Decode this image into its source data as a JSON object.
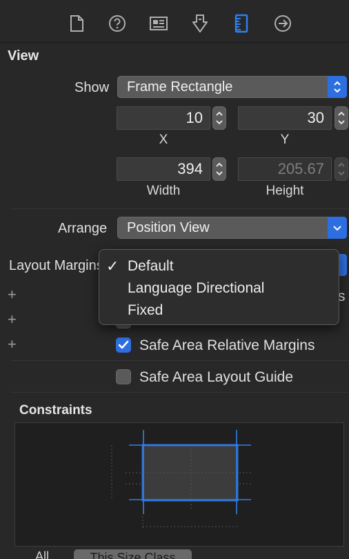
{
  "toolbar": {
    "icons": [
      "file-icon",
      "help-icon",
      "identity-icon",
      "attributes-icon",
      "size-ruler-icon",
      "connections-icon"
    ],
    "selected_icon": "size-ruler-icon",
    "accent": "#2f80ed"
  },
  "view": {
    "title": "View",
    "show_label": "Show",
    "show_value": "Frame Rectangle",
    "x_value": "10",
    "y_value": "30",
    "x_label": "X",
    "y_label": "Y",
    "width_value": "394",
    "height_value": "205.67",
    "width_label": "Width",
    "height_label": "Height",
    "arrange_label": "Arrange",
    "arrange_value": "Position View",
    "layout_margins_label": "Layout Margins",
    "hidden_trailing_text": "s",
    "safe_area_relative_label": "Safe Area Relative Margins",
    "safe_area_relative_checked": true,
    "safe_area_guide_label": "Safe Area Layout Guide",
    "safe_area_guide_checked": false
  },
  "menu": {
    "items": [
      "Default",
      "Language Directional",
      "Fixed"
    ],
    "selected": "Default",
    "check_glyph": "✓"
  },
  "plus_glyph": "+",
  "constraints": {
    "title": "Constraints",
    "tabs": [
      "All",
      "This Size Class"
    ],
    "selected_tab": "This Size Class"
  }
}
